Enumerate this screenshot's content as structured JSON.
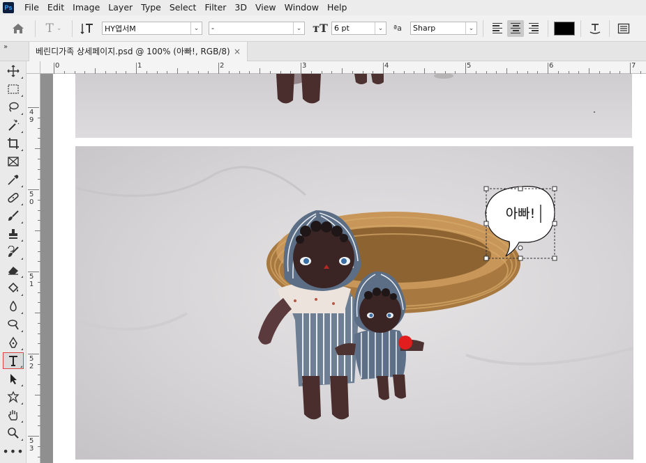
{
  "app": {
    "logo": "Ps"
  },
  "menu": [
    "File",
    "Edit",
    "Image",
    "Layer",
    "Type",
    "Select",
    "Filter",
    "3D",
    "View",
    "Window",
    "Help"
  ],
  "options": {
    "font_family": "HY엽서M",
    "font_style": "-",
    "font_size": "6 pt",
    "aa_label": "ªa",
    "anti_alias": "Sharp",
    "text_color": "#000000"
  },
  "document": {
    "tab_title": "베린디가족 상세페이지.psd @ 100% (아빠!, RGB/8)",
    "close_glyph": "×"
  },
  "ruler": {
    "top_labels": [
      "0",
      "1",
      "2",
      "3",
      "4",
      "5",
      "6",
      "7"
    ],
    "left_labels": [
      "4 9",
      "5 0",
      "5 1",
      "5 2",
      "5 3"
    ]
  },
  "canvas": {
    "speech_bubble_text": "아빠!"
  },
  "tools": [
    "move-tool",
    "marquee-tool",
    "lasso-tool",
    "magic-wand-tool",
    "crop-tool",
    "frame-tool",
    "eyedropper-tool",
    "healing-brush-tool",
    "brush-tool",
    "clone-stamp-tool",
    "history-brush-tool",
    "eraser-tool",
    "paint-bucket-tool",
    "blur-tool",
    "dodge-tool",
    "pen-tool",
    "type-tool",
    "path-selection-tool",
    "custom-shape-tool",
    "hand-tool",
    "zoom-tool",
    "more-tools"
  ],
  "active_tool": "type-tool"
}
